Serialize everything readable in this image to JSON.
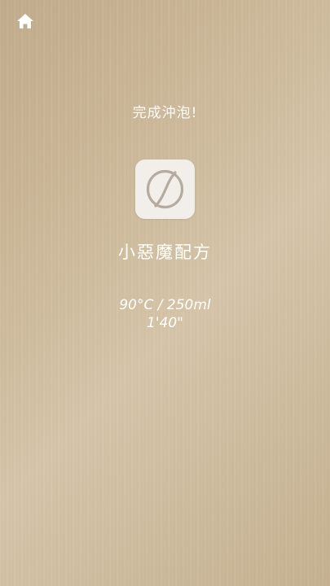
{
  "nav": {
    "home_icon": "home-icon"
  },
  "brew": {
    "status": "完成沖泡!",
    "recipe_icon": "coffee-bean-icon",
    "recipe_name": "小惡魔配方",
    "temperature_volume": "90°C / 250ml",
    "duration": "1'40\""
  },
  "colors": {
    "background": "#cdb99a",
    "icon_tile": "#f2eeea",
    "icon_stroke": "#b5aba0",
    "text": "#ffffff"
  }
}
